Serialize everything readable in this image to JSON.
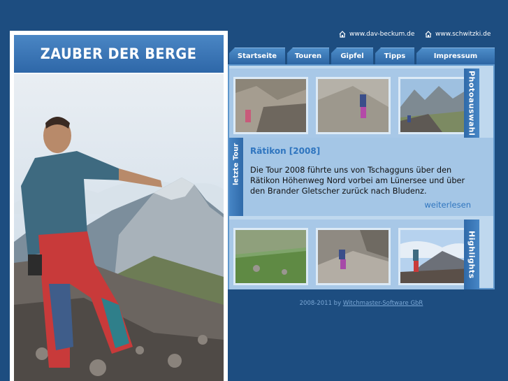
{
  "header": {
    "links": [
      {
        "label": "www.dav-beckum.de",
        "icon": "home-icon"
      },
      {
        "label": "www.schwitzki.de",
        "icon": "home-icon"
      }
    ]
  },
  "site": {
    "title": "ZAUBER DER BERGE"
  },
  "nav": {
    "tabs": [
      "Startseite",
      "Touren",
      "Gipfel",
      "Tipps",
      "Impressum"
    ]
  },
  "photos": {
    "label": "Photoauswahl"
  },
  "tour": {
    "label": "letzte Tour",
    "title": "Rätikon [2008]",
    "text": "Die Tour 2008 führte uns von Tschagguns über den Rätikon Höhenweg Nord vorbei am Lünersee und über den Brander Gletscher zurück nach Bludenz.",
    "more": "weiterlesen"
  },
  "highlights": {
    "label": "Highlights"
  },
  "footer": {
    "years": "2008-2011 by",
    "company": "Witchmaster-Software GbR"
  },
  "colors": {
    "background": "#1d4d80",
    "accent": "#2f75bf",
    "panel": "#bfd8ee"
  }
}
